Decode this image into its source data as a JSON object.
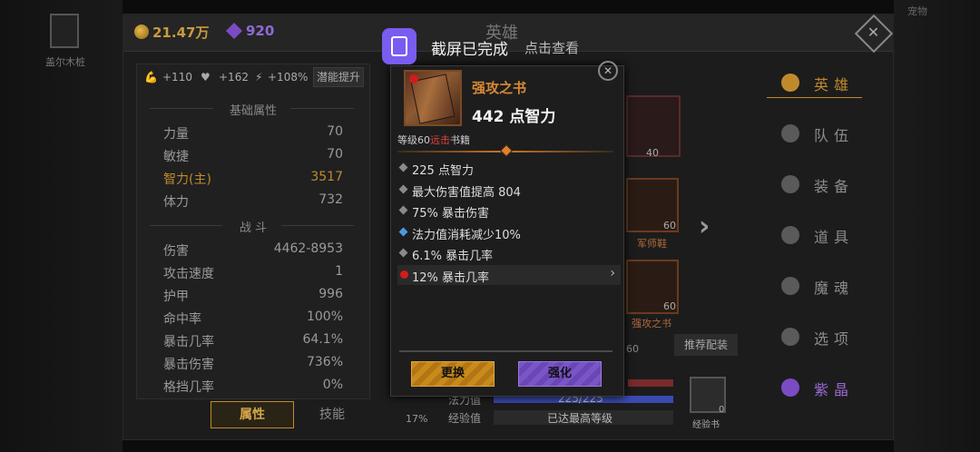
{
  "header": {
    "gold": "21.47万",
    "gems": "920",
    "title": "英雄",
    "close_glyph": "✕",
    "left_char_label": "盖尔木桩",
    "right_top_label": "宠物"
  },
  "toast": {
    "title": "截屏已完成",
    "subtitle": "点击查看"
  },
  "stat_bar": {
    "power_bonus": "+110",
    "hp_bonus": "+162",
    "speed_bonus": "+108%",
    "potential_button": "潜能提升"
  },
  "basic_attrs": {
    "title": "基础属性",
    "rows": [
      {
        "label": "力量",
        "value": "70"
      },
      {
        "label": "敏捷",
        "value": "70"
      },
      {
        "label": "智力(主)",
        "value": "3517"
      },
      {
        "label": "体力",
        "value": "732"
      }
    ]
  },
  "combat": {
    "title": "战 斗",
    "rows": [
      {
        "label": "伤害",
        "value": "4462-8953"
      },
      {
        "label": "攻击速度",
        "value": "1"
      },
      {
        "label": "护甲",
        "value": "996"
      },
      {
        "label": "命中率",
        "value": "100%"
      },
      {
        "label": "暴击几率",
        "value": "64.1%"
      },
      {
        "label": "暴击伤害",
        "value": "736%"
      },
      {
        "label": "格挡几率",
        "value": "0%"
      }
    ]
  },
  "tabs": {
    "attributes": "属性",
    "skills": "技能"
  },
  "nav": {
    "items": [
      {
        "label": "英雄",
        "icon": "hero-icon"
      },
      {
        "label": "队伍",
        "icon": "flag-icon"
      },
      {
        "label": "装备",
        "icon": "helmet-icon"
      },
      {
        "label": "道具",
        "icon": "bag-icon"
      },
      {
        "label": "魔魂",
        "icon": "flame-icon"
      },
      {
        "label": "选项",
        "icon": "gear-icon"
      },
      {
        "label": "紫晶",
        "icon": "crystal-icon"
      }
    ]
  },
  "equipment": {
    "slot1_level": "40",
    "slot2_level": "60",
    "slot2_name": "军师鞋",
    "slot3_level": "60",
    "slot3_name": "强攻之书",
    "slot4_level": "60",
    "recommend_button": "推荐配装",
    "mana_label": "法力值",
    "mana_value": "225/225",
    "exp_label": "经验值",
    "exp_value": "已达最高等级",
    "exp_percent": "17%",
    "expbook_label": "经验书",
    "expbook_count": "0"
  },
  "item": {
    "name": "强攻之书",
    "main_stat": "442 点智力",
    "level_prefix": "等级60",
    "level_tag": "远击",
    "level_suffix": "书籍",
    "affixes": [
      {
        "text": "225 点智力",
        "bullet_color": "#8a8a8a"
      },
      {
        "text": "最大伤害值提高 804",
        "bullet_color": "#8a8a8a"
      },
      {
        "text": "75% 暴击伤害",
        "bullet_color": "#8a8a8a"
      },
      {
        "text": "法力值消耗减少10%",
        "bullet_color": "#4a9ae0"
      },
      {
        "text": "6.1% 暴击几率",
        "bullet_color": "#8a8a8a"
      },
      {
        "text": "12% 暴击几率",
        "bullet_color": "#d21c1c"
      }
    ],
    "change_button": "更换",
    "enhance_button": "强化",
    "chevron": "›"
  },
  "colors": {
    "gold": "#c99b3c",
    "purple": "#8f6ad4",
    "accent_orange": "#c08a2c"
  }
}
